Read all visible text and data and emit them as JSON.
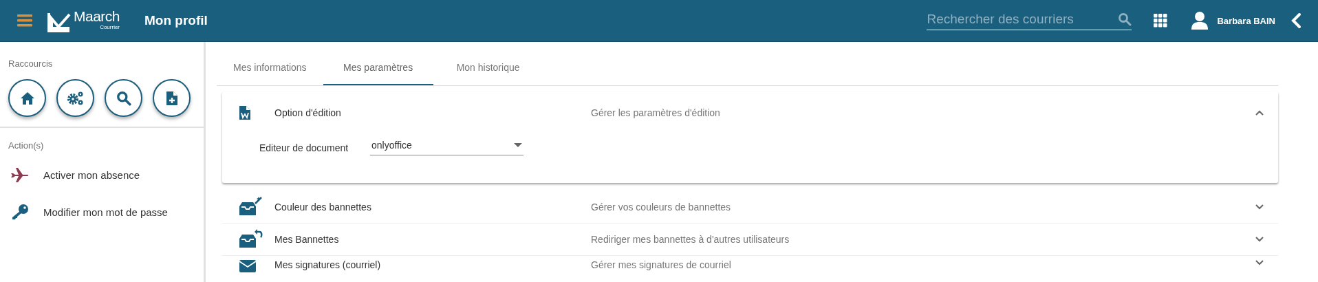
{
  "header": {
    "logo": {
      "name": "Maarch",
      "subtitle": "Courrier"
    },
    "title": "Mon profil",
    "search": {
      "placeholder": "Rechercher des courriers"
    },
    "user": "Barbara BAIN"
  },
  "sidebar": {
    "shortcuts_title": "Raccourcis",
    "shortcuts": [
      {
        "kind": "home"
      },
      {
        "kind": "admin"
      },
      {
        "kind": "search"
      },
      {
        "kind": "create"
      }
    ],
    "actions_title": "Action(s)",
    "actions": [
      {
        "kind": "plane",
        "label": "Activer mon absence"
      },
      {
        "kind": "key",
        "label": "Modifier mon mot de passe"
      }
    ]
  },
  "tabs": [
    {
      "label": "Mes informations",
      "selected": false
    },
    {
      "label": "Mes paramètres",
      "selected": true
    },
    {
      "label": "Mon historique",
      "selected": false
    }
  ],
  "panels": [
    {
      "kind": "edit",
      "title": "Option d'édition",
      "description": "Gérer les paramètres d'édition",
      "expanded": true,
      "field": {
        "label": "Editeur de document",
        "value": "onlyoffice"
      }
    },
    {
      "kind": "colors",
      "title": "Couleur des bannettes",
      "description": "Gérer vos couleurs de bannettes",
      "expanded": false
    },
    {
      "kind": "redirect",
      "title": "Mes Bannettes",
      "description": "Rediriger mes bannettes à d'autres utilisateurs",
      "expanded": false
    },
    {
      "kind": "mail",
      "title": "Mes signatures (courriel)",
      "description": "Gérer mes signatures de courriel",
      "expanded": false
    }
  ]
}
